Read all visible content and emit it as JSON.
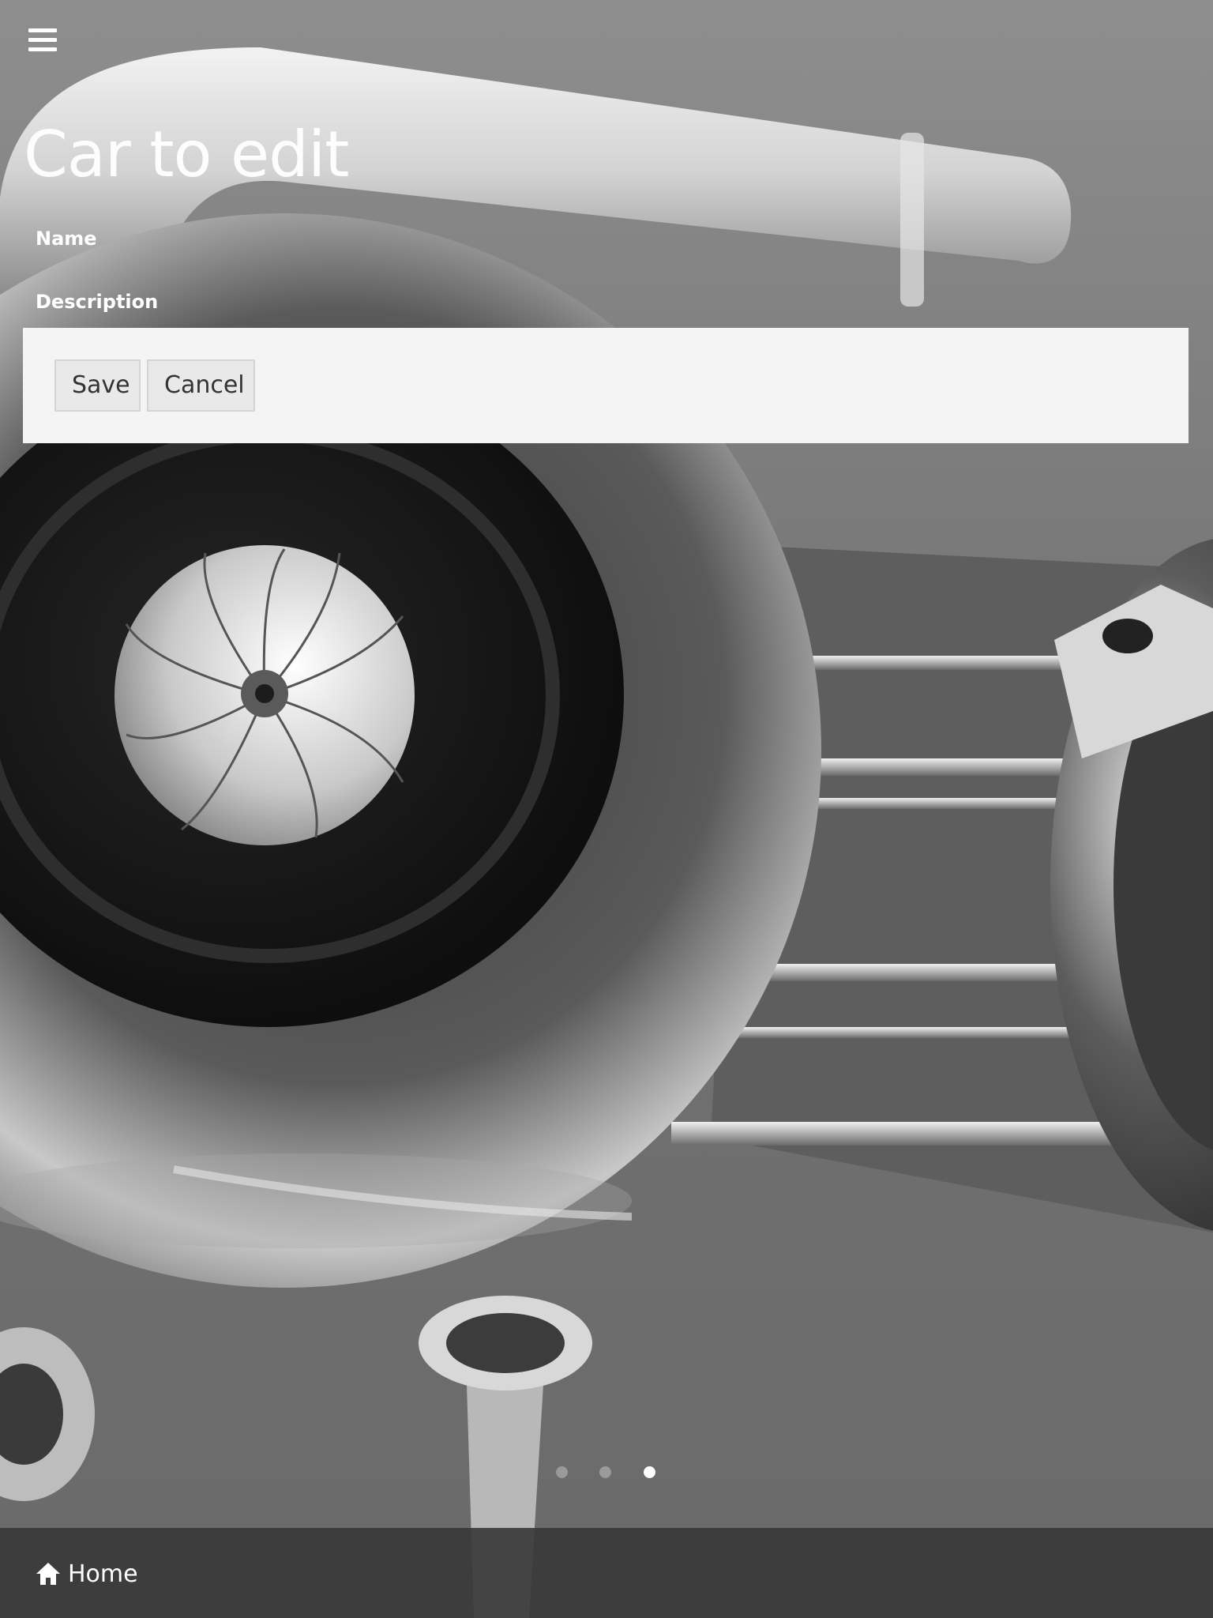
{
  "header": {
    "menu_icon": "hamburger-menu-icon",
    "title": "Car to edit"
  },
  "form": {
    "fields": [
      {
        "label": "Name"
      },
      {
        "label": "Description"
      }
    ],
    "actions": {
      "save_label": "Save",
      "cancel_label": "Cancel"
    }
  },
  "carousel": {
    "slide_count": 3,
    "active_index": 2
  },
  "footer": {
    "home_icon": "home-icon",
    "home_label": "Home"
  },
  "colors": {
    "panel_background": "#f4f4f5",
    "footer_background": "#3a3a3a",
    "text_light": "#ffffff",
    "button_background": "#e9e9e9"
  }
}
